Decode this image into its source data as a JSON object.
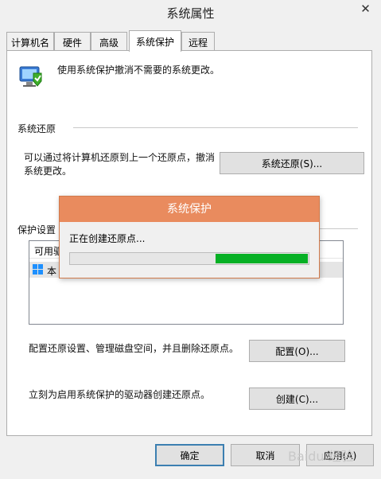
{
  "window": {
    "title": "系统属性",
    "close_glyph": "✕"
  },
  "tabs": [
    {
      "label": "计算机名"
    },
    {
      "label": "硬件"
    },
    {
      "label": "高级"
    },
    {
      "label": "系统保护",
      "active": true
    },
    {
      "label": "远程"
    }
  ],
  "intro": {
    "text": "使用系统保护撤消不需要的系统更改。",
    "icon": "system-protection-icon"
  },
  "restore_group": {
    "label": "系统还原",
    "description_line1": "可以通过将计算机还原到上一个还原点，撤消",
    "description_line2": "系统更改。",
    "button": "系统还原(S)..."
  },
  "protection_group": {
    "label": "保护设置",
    "column_header": "可用驱",
    "row_text": "本",
    "row_icon": "windows-drive-icon"
  },
  "configure": {
    "text": "配置还原设置、管理磁盘空间，并且删除还原点。",
    "button": "配置(O)..."
  },
  "create": {
    "text": "立刻为启用系统保护的驱动器创建还原点。",
    "button": "创建(C)..."
  },
  "footer": {
    "ok": "确定",
    "cancel": "取消",
    "apply": "应用(A)"
  },
  "modal": {
    "title": "系统保护",
    "status": "正在创建还原点...",
    "progress": {
      "start": 0.61,
      "end": 1.0
    }
  },
  "watermark": "Baidu 经验",
  "colors": {
    "modal_title": "#e98b5e",
    "progress": "#06b025",
    "default_border": "#3c7fb1"
  }
}
